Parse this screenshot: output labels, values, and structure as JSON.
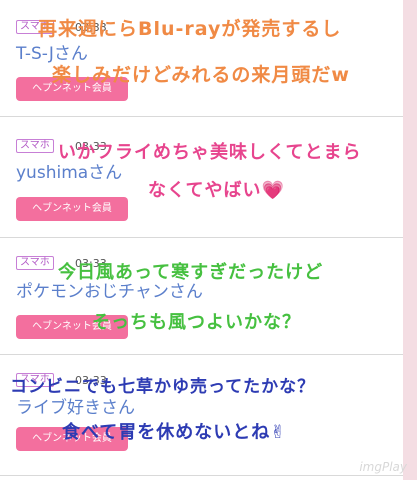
{
  "posts": [
    {
      "badge": "スマホ",
      "time": "03:33",
      "user": "T-S-Jさん",
      "button": "ヘプンネット会員",
      "overlay": [
        "再来週にらBlu-rayが発売するし",
        "楽しみだけどみれるの来月頭だw"
      ]
    },
    {
      "badge": "スマホ",
      "time": "03:33",
      "user": "yushimaさん",
      "button": "ヘブンネット会員",
      "overlay": [
        "いかフライめちゃ美味しくてとまら",
        "なくてやばい💗"
      ]
    },
    {
      "badge": "スマホ",
      "time": "03:33",
      "user": "ポケモンおじチャンさん",
      "button": "ヘブンネット会員",
      "overlay": [
        "今日風あって寒すぎだったけど",
        "そっちも風つよいかな？"
      ]
    },
    {
      "badge": "スマホ",
      "time": "03:33",
      "user": "ライブ好きさん",
      "button": "ヘブンネット会員",
      "overlay": [
        "コンビニでも七草かゆ売ってたかな？",
        "食べて胃を休めないとね✌"
      ]
    }
  ],
  "watermark": "imgPlay",
  "colors": {
    "button": "#f36f9e",
    "username": "#5b7fcb",
    "badge": "#b25ac6",
    "overlay_orange": "#f08a45",
    "overlay_pink": "#e7458e",
    "overlay_green": "#46c040",
    "overlay_navy": "#2d3bb3"
  }
}
